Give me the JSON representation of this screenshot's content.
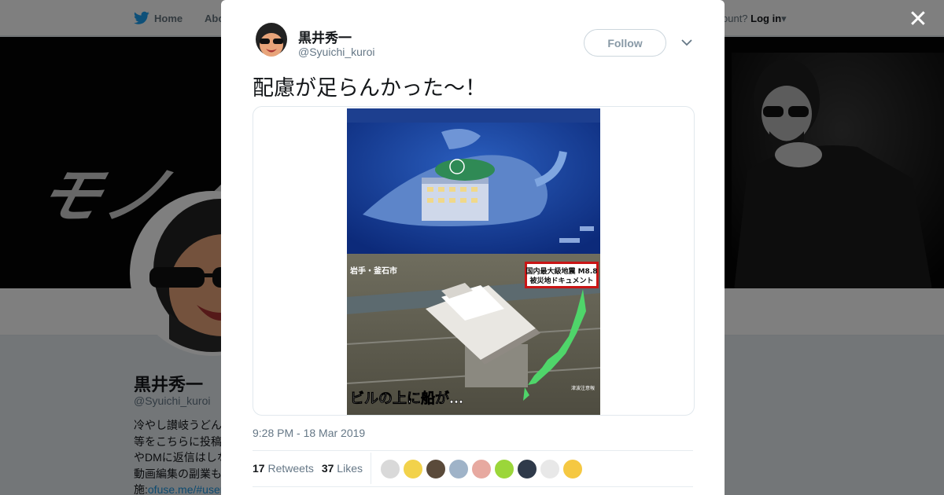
{
  "topbar": {
    "home_label": "Home",
    "about_label": "Abo",
    "login_prefix": "ccount?",
    "login_label": "Log in"
  },
  "banner": {
    "logo_text": "モノノ"
  },
  "profile": {
    "name": "黒井秀一",
    "handle": "@Syuichi_kuroi",
    "bio_lines": [
      "冷やし讃岐うどん",
      "等をこちらに投稿",
      "やDMに返信はしな",
      "動画編集の副業も"
    ],
    "bio_link_prefix": "施:",
    "bio_link": "ofuse.me/#user"
  },
  "tweet": {
    "author_name": "黒井秀一",
    "author_handle": "@Syuichi_kuroi",
    "follow_label": "Follow",
    "text": "配慮が足らんかった〜！",
    "timestamp": "9:28 PM - 18 Mar 2019",
    "retweets_count": "17",
    "retweets_label": "Retweets",
    "likes_count": "37",
    "likes_label": "Likes"
  },
  "media": {
    "caption_location": "岩手・釜石市",
    "caption_headline_1": "国内最大級地震 M8.8",
    "caption_headline_2": "被災地ドキュメント",
    "caption_bottom": "ビルの上に船が…",
    "caption_map_note": "津波注意報"
  },
  "liker_colors": [
    "#d9d9d9",
    "#f2d24b",
    "#5a4a3a",
    "#9fb3c8",
    "#e7a9a0",
    "#9bd63a",
    "#2f3a4a",
    "#e8e8e8",
    "#f5c842"
  ],
  "colors": {
    "accent": "#1da1f2",
    "text": "#14171a",
    "muted": "#657786"
  }
}
